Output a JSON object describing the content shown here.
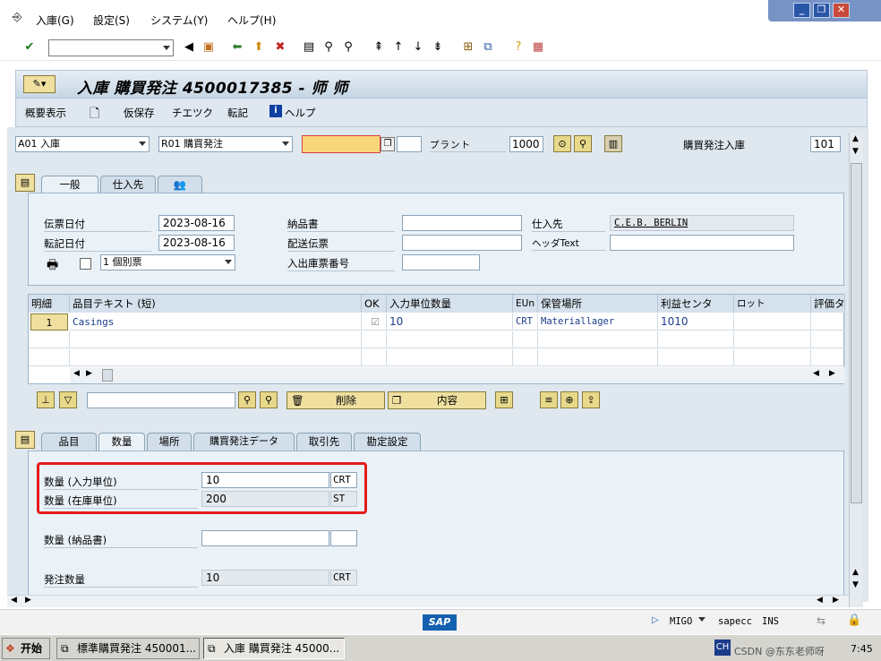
{
  "menu": {
    "items": [
      "入庫(G)",
      "設定(S)",
      "システム(Y)",
      "ヘルプ(H)"
    ]
  },
  "toolbar": {
    "command_value": ""
  },
  "header": {
    "title": "入庫 購買発注 4500017385 - 师 师"
  },
  "app_toolbar": {
    "overview": "概要表示",
    "hold": "仮保存",
    "check": "チエツク",
    "post": "転記",
    "help": "ヘルプ"
  },
  "selection": {
    "transaction": "A01 入庫",
    "reference": "R01 購買発注",
    "po_number": "",
    "plant_label": "プラント",
    "plant_value": "1000",
    "movement_label": "購買発注入庫",
    "movement_value": "101"
  },
  "header_tabs": [
    "一般",
    "仕入先"
  ],
  "general": {
    "doc_date_label": "伝票日付",
    "doc_date": "2023-08-16",
    "post_date_label": "転記日付",
    "post_date": "2023-08-16",
    "print_option": "1 個別票",
    "delivery_note_label": "納品書",
    "delivery_note": "",
    "bill_of_lading_label": "配送伝票",
    "bill_of_lading": "",
    "gr_slip_label": "入出庫票番号",
    "gr_slip": "",
    "vendor_label": "仕入先",
    "vendor": "C.E.B. BERLIN",
    "header_text_label": "ヘッダText",
    "header_text": ""
  },
  "grid": {
    "columns": [
      "明細",
      "品目テキスト (短)",
      "OK",
      "入力単位数量",
      "EUn",
      "保管場所",
      "利益センタ",
      "ロット",
      "評価タ"
    ],
    "rows": [
      {
        "line": "1",
        "text": "Casings",
        "qty": "10",
        "unit": "CRT",
        "sloc": "Materiallager",
        "profit_center": "1010"
      }
    ]
  },
  "item_buttons": {
    "delete": "削除",
    "contents": "内容",
    "search_value": ""
  },
  "item_tabs": [
    "品目",
    "数量",
    "場所",
    "購買発注データ",
    "取引先",
    "勘定設定"
  ],
  "quantity": {
    "qty_entry_label": "数量 (入力単位)",
    "qty_entry": "10",
    "qty_entry_unit": "CRT",
    "qty_sku_label": "数量 (在庫単位)",
    "qty_sku": "200",
    "qty_sku_unit": "ST",
    "qty_delnote_label": "数量 (納品書)",
    "qty_delnote": "",
    "qty_delnote_unit": "",
    "qty_ordered_label": "発注数量",
    "qty_ordered": "10",
    "qty_ordered_unit": "CRT"
  },
  "status": {
    "sap_logo": "SAP",
    "tcode": "MIGO",
    "system": "sapecc",
    "mode": "INS"
  },
  "taskbar": {
    "start": "开始",
    "task1": "標準購買発注 450001...",
    "task2": "入庫 購買発注 45000...",
    "lang": "CH",
    "time": "7:45",
    "watermark": "CSDN @东东老师呀"
  }
}
